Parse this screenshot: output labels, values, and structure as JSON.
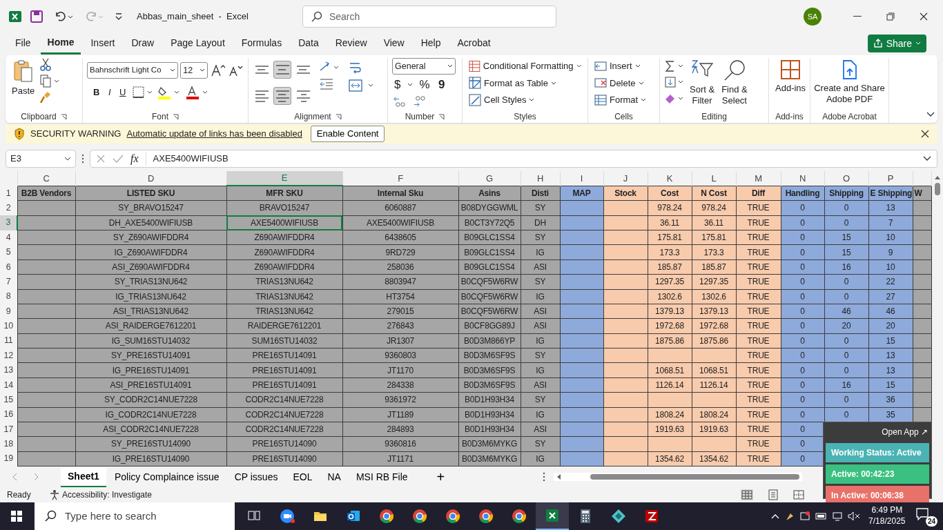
{
  "title_bar": {
    "title": "Abbas_main_sheet  -  Excel",
    "search_placeholder": "Search",
    "avatar": "SA"
  },
  "menu_tabs": [
    {
      "label": "File",
      "selected": false
    },
    {
      "label": "Home",
      "selected": true
    },
    {
      "label": "Insert",
      "selected": false
    },
    {
      "label": "Draw",
      "selected": false
    },
    {
      "label": "Page Layout",
      "selected": false
    },
    {
      "label": "Formulas",
      "selected": false
    },
    {
      "label": "Data",
      "selected": false
    },
    {
      "label": "Review",
      "selected": false
    },
    {
      "label": "View",
      "selected": false
    },
    {
      "label": "Help",
      "selected": false
    },
    {
      "label": "Acrobat",
      "selected": false
    }
  ],
  "share_button": "Share",
  "ribbon": {
    "clipboard": {
      "paste": "Paste",
      "label": "Clipboard"
    },
    "font": {
      "name": "Bahnschrift Light Co",
      "size": "12",
      "bold": "B",
      "italic": "I",
      "underline": "U",
      "label": "Font"
    },
    "alignment": {
      "label": "Alignment",
      "buttons": [
        {
          "kind": "top",
          "selected": false
        },
        {
          "kind": "middle",
          "selected": true
        },
        {
          "kind": "bottom",
          "selected": false
        },
        {
          "kind": "left",
          "selected": false
        },
        {
          "kind": "center",
          "selected": true
        },
        {
          "kind": "right",
          "selected": false
        }
      ]
    },
    "number": {
      "format": "General",
      "currency": "$",
      "percent": "%",
      "comma": "9",
      "label": "Number"
    },
    "styles": {
      "items": [
        "Conditional Formatting",
        "Format as Table",
        "Cell Styles"
      ],
      "label": "Styles"
    },
    "cells": {
      "items": [
        "Insert",
        "Delete",
        "Format"
      ],
      "label": "Cells"
    },
    "editing": {
      "sort": [
        "Sort &",
        "Filter"
      ],
      "find": [
        "Find &",
        "Select"
      ],
      "label": "Editing"
    },
    "addins": {
      "button": "Add-ins",
      "label": "Add-ins"
    },
    "acrobat": {
      "button": [
        "Create and Share",
        "Adobe PDF"
      ],
      "label": "Adobe Acrobat"
    }
  },
  "security_bar": {
    "label": "SECURITY WARNING",
    "message": "Automatic update of links has been disabled",
    "button": "Enable Content"
  },
  "formula_bar": {
    "name_box": "E3",
    "fx": "fx",
    "formula": "AXE5400WIFIUSB"
  },
  "sheet": {
    "columns": [
      {
        "letter": "C",
        "header": "B2B Vendors",
        "color": "#a6a6a6",
        "selected": false
      },
      {
        "letter": "D",
        "header": "LISTED SKU",
        "color": "#a6a6a6",
        "selected": false
      },
      {
        "letter": "E",
        "header": "MFR SKU",
        "color": "#a6a6a6",
        "selected": true
      },
      {
        "letter": "F",
        "header": "Internal Sku",
        "color": "#a6a6a6",
        "selected": false
      },
      {
        "letter": "G",
        "header": "Asins",
        "color": "#a6a6a6",
        "selected": false
      },
      {
        "letter": "H",
        "header": "Disti",
        "color": "#a6a6a6",
        "selected": false
      },
      {
        "letter": "I",
        "header": "MAP",
        "color": "#8eaadb",
        "selected": false
      },
      {
        "letter": "J",
        "header": "Stock",
        "color": "#f8cbad",
        "selected": false
      },
      {
        "letter": "K",
        "header": "Cost",
        "color": "#f8cbad",
        "selected": false
      },
      {
        "letter": "L",
        "header": "N Cost",
        "color": "#f8cbad",
        "selected": false
      },
      {
        "letter": "M",
        "header": "Diff",
        "color": "#f8cbad",
        "selected": false
      },
      {
        "letter": "N",
        "header": "Handling",
        "color": "#8eaadb",
        "selected": false
      },
      {
        "letter": "O",
        "header": "Shipping",
        "color": "#8eaadb",
        "selected": false
      },
      {
        "letter": "P",
        "header": "E Shipping",
        "color": "#8eaadb",
        "selected": false
      },
      {
        "header": "W",
        "color": "#a6a6a6",
        "selected": false
      }
    ],
    "header_row": "1",
    "rows": [
      {
        "number": "2",
        "selected": false,
        "cells": {
          "D": "SY_BRAVO15247",
          "E": "BRAVO15247",
          "F": "6060887",
          "G": "B08DYGGWML",
          "H": "SY",
          "K": "978.24",
          "L": "978.24",
          "M": "TRUE",
          "N": "0",
          "O": "0",
          "P": "13"
        }
      },
      {
        "number": "3",
        "selected": true,
        "cells": {
          "D": "DH_AXE5400WIFIUSB",
          "E": "AXE5400WIFIUSB",
          "F": "AXE5400WIFIUSB",
          "G": "B0CT3Y72Q5",
          "H": "DH",
          "K": "36.11",
          "L": "36.11",
          "M": "TRUE",
          "N": "0",
          "O": "0",
          "P": "7"
        }
      },
      {
        "number": "4",
        "selected": false,
        "cells": {
          "D": "SY_Z690AWIFDDR4",
          "E": "Z690AWIFDDR4",
          "F": "6438605",
          "G": "B09GLC1SS4",
          "H": "SY",
          "K": "175.81",
          "L": "175.81",
          "M": "TRUE",
          "N": "0",
          "O": "15",
          "P": "10"
        }
      },
      {
        "number": "5",
        "selected": false,
        "cells": {
          "D": "IG_Z690AWIFDDR4",
          "E": "Z690AWIFDDR4",
          "F": "9RD729",
          "G": "B09GLC1SS4",
          "H": "IG",
          "K": "173.3",
          "L": "173.3",
          "M": "TRUE",
          "N": "0",
          "O": "15",
          "P": "9"
        }
      },
      {
        "number": "6",
        "selected": false,
        "cells": {
          "D": "ASI_Z690AWIFDDR4",
          "E": "Z690AWIFDDR4",
          "F": "258036",
          "G": "B09GLC1SS4",
          "H": "ASI",
          "K": "185.87",
          "L": "185.87",
          "M": "TRUE",
          "N": "0",
          "O": "16",
          "P": "10"
        }
      },
      {
        "number": "7",
        "selected": false,
        "cells": {
          "D": "SY_TRIAS13NU642",
          "E": "TRIAS13NU642",
          "F": "8803947",
          "G": "B0CQF5W6RW",
          "H": "SY",
          "K": "1297.35",
          "L": "1297.35",
          "M": "TRUE",
          "N": "0",
          "O": "0",
          "P": "22"
        }
      },
      {
        "number": "8",
        "selected": false,
        "cells": {
          "D": "IG_TRIAS13NU642",
          "E": "TRIAS13NU642",
          "F": "HT3754",
          "G": "B0CQF5W6RW",
          "H": "IG",
          "K": "1302.6",
          "L": "1302.6",
          "M": "TRUE",
          "N": "0",
          "O": "0",
          "P": "27"
        }
      },
      {
        "number": "9",
        "selected": false,
        "cells": {
          "D": "ASI_TRIAS13NU642",
          "E": "TRIAS13NU642",
          "F": "279015",
          "G": "B0CQF5W6RW",
          "H": "ASI",
          "K": "1379.13",
          "L": "1379.13",
          "M": "TRUE",
          "N": "0",
          "O": "46",
          "P": "46"
        }
      },
      {
        "number": "10",
        "selected": false,
        "cells": {
          "D": "ASI_RAIDERGE7612201",
          "E": "RAIDERGE7612201",
          "F": "276843",
          "G": "B0CF8GG89J",
          "H": "ASI",
          "K": "1972.68",
          "L": "1972.68",
          "M": "TRUE",
          "N": "0",
          "O": "20",
          "P": "20"
        }
      },
      {
        "number": "11",
        "selected": false,
        "cells": {
          "D": "IG_SUM16STU14032",
          "E": "SUM16STU14032",
          "F": "JR1307",
          "G": "B0D3M866YP",
          "H": "IG",
          "K": "1875.86",
          "L": "1875.86",
          "M": "TRUE",
          "N": "0",
          "O": "0",
          "P": "15"
        }
      },
      {
        "number": "12",
        "selected": false,
        "cells": {
          "D": "SY_PRE16STU14091",
          "E": "PRE16STU14091",
          "F": "9360803",
          "G": "B0D3M6SF9S",
          "H": "SY",
          "M": "TRUE",
          "N": "0",
          "O": "0",
          "P": "13"
        }
      },
      {
        "number": "13",
        "selected": false,
        "cells": {
          "D": "IG_PRE16STU14091",
          "E": "PRE16STU14091",
          "F": "JT1170",
          "G": "B0D3M6SF9S",
          "H": "IG",
          "K": "1068.51",
          "L": "1068.51",
          "M": "TRUE",
          "N": "0",
          "O": "0",
          "P": "13"
        }
      },
      {
        "number": "14",
        "selected": false,
        "cells": {
          "D": "ASI_PRE16STU14091",
          "E": "PRE16STU14091",
          "F": "284338",
          "G": "B0D3M6SF9S",
          "H": "ASI",
          "K": "1126.14",
          "L": "1126.14",
          "M": "TRUE",
          "N": "0",
          "O": "16",
          "P": "15"
        }
      },
      {
        "number": "15",
        "selected": false,
        "cells": {
          "D": "SY_CODR2C14NUE7228",
          "E": "CODR2C14NUE7228",
          "F": "9361972",
          "G": "B0D1H93H34",
          "H": "SY",
          "M": "TRUE",
          "N": "0",
          "O": "0",
          "P": "36"
        }
      },
      {
        "number": "16",
        "selected": false,
        "cells": {
          "D": "IG_CODR2C14NUE7228",
          "E": "CODR2C14NUE7228",
          "F": "JT1189",
          "G": "B0D1H93H34",
          "H": "IG",
          "K": "1808.24",
          "L": "1808.24",
          "M": "TRUE",
          "N": "0",
          "O": "0",
          "P": "35"
        }
      },
      {
        "number": "17",
        "selected": false,
        "cells": {
          "D": "ASI_CODR2C14NUE7228",
          "E": "CODR2C14NUE7228",
          "F": "284893",
          "G": "B0D1H93H34",
          "H": "ASI",
          "K": "1919.63",
          "L": "1919.63",
          "M": "TRUE",
          "N": "0"
        }
      },
      {
        "number": "18",
        "selected": false,
        "cells": {
          "D": "SY_PRE16STU14090",
          "E": "PRE16STU14090",
          "F": "9360816",
          "G": "B0D3M6MYKG",
          "H": "SY",
          "M": "TRUE",
          "N": "0"
        }
      },
      {
        "number": "19",
        "selected": false,
        "cells": {
          "D": "IG_PRE16STU14090",
          "E": "PRE16STU14090",
          "F": "JT1171",
          "G": "B0D3M6MYKG",
          "H": "IG",
          "K": "1354.62",
          "L": "1354.62",
          "M": "TRUE",
          "N": "0"
        }
      }
    ]
  },
  "sheet_tabs": [
    {
      "label": "Sheet1",
      "selected": true
    },
    {
      "label": "Policy Complaince issue",
      "selected": false
    },
    {
      "label": "CP issues",
      "selected": false
    },
    {
      "label": "EOL",
      "selected": false
    },
    {
      "label": "NA",
      "selected": false
    },
    {
      "label": "MSI RB File",
      "selected": false
    }
  ],
  "add_sheet": "+",
  "status_bar": {
    "ready": "Ready",
    "accessibility": "Accessibility: Investigate"
  },
  "tracker_widget": {
    "open_app": "Open App ↗",
    "status": "Working Status: Active",
    "active": "Active: 00:42:23",
    "inactive": "In Active: 00:06:38"
  },
  "taskbar": {
    "search_placeholder": "Type here to search",
    "apps": [
      {
        "kind": "task-view",
        "selected": false
      },
      {
        "kind": "zoom",
        "selected": false
      },
      {
        "kind": "folder",
        "selected": false
      },
      {
        "kind": "outlook",
        "selected": false
      },
      {
        "kind": "chrome",
        "selected": false
      },
      {
        "kind": "chrome",
        "selected": false
      },
      {
        "kind": "chrome",
        "selected": false
      },
      {
        "kind": "chrome",
        "selected": false
      },
      {
        "kind": "chrome",
        "selected": false
      },
      {
        "kind": "excel",
        "selected": true
      },
      {
        "kind": "calculator",
        "selected": false
      },
      {
        "kind": "diamond",
        "selected": false
      },
      {
        "kind": "filezilla",
        "selected": false
      }
    ],
    "time": "6:49 PM",
    "date": "7/18/2025",
    "notifications": "24"
  }
}
